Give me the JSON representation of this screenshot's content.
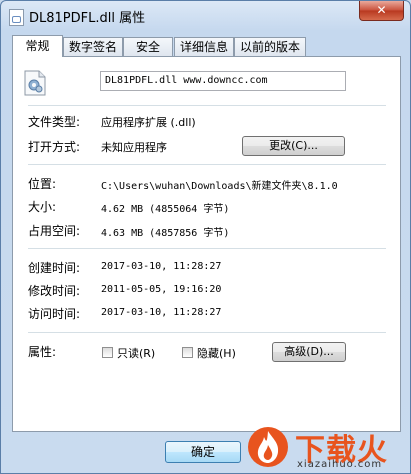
{
  "window": {
    "title": "DL81PDFL.dll 属性",
    "close_label": "✕"
  },
  "tabs": [
    {
      "label": "常规",
      "active": true
    },
    {
      "label": "数字签名",
      "active": false
    },
    {
      "label": "安全",
      "active": false
    },
    {
      "label": "详细信息",
      "active": false
    },
    {
      "label": "以前的版本",
      "active": false
    }
  ],
  "general": {
    "file_name": "DL81PDFL.dll  www.downcc.com",
    "file_type_label": "文件类型:",
    "file_type_value": "应用程序扩展 (.dll)",
    "open_with_label": "打开方式:",
    "open_with_value": "未知应用程序",
    "change_button": "更改(C)...",
    "location_label": "位置:",
    "location_value": "C:\\Users\\wuhan\\Downloads\\新建文件夹\\8.1.0",
    "size_label": "大小:",
    "size_value": "4.62 MB (4855064 字节)",
    "size_on_disk_label": "占用空间:",
    "size_on_disk_value": "4.63 MB (4857856 字节)",
    "created_label": "创建时间:",
    "created_value": "2017-03-10, 11:28:27",
    "modified_label": "修改时间:",
    "modified_value": "2011-05-05, 19:16:20",
    "accessed_label": "访问时间:",
    "accessed_value": "2017-03-10, 11:28:27",
    "attributes_label": "属性:",
    "readonly_label": "只读(R)",
    "hidden_label": "隐藏(H)",
    "advanced_button": "高级(D)..."
  },
  "footer": {
    "ok_button": "确定"
  },
  "watermark": {
    "text": "下载火",
    "sub": "xiazaihuo.com"
  }
}
